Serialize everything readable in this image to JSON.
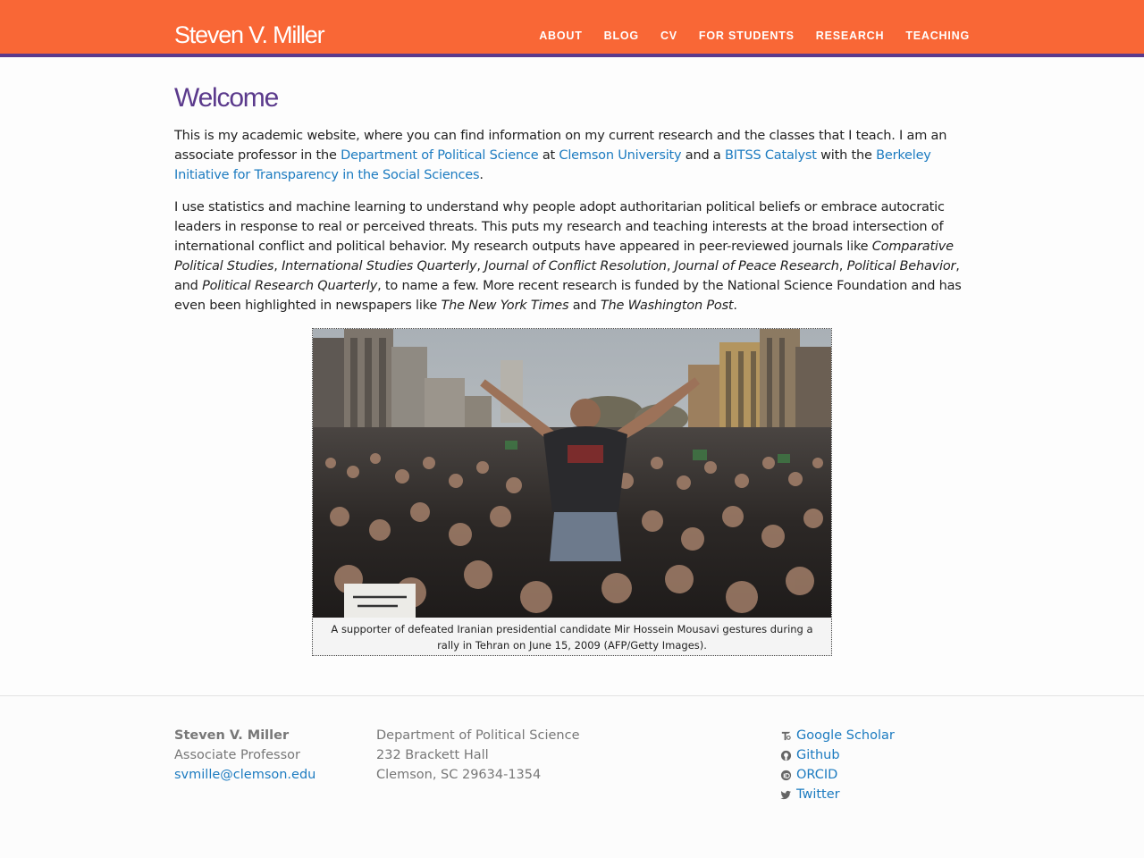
{
  "header": {
    "brand": "Steven V. Miller",
    "nav": [
      "ABOUT",
      "BLOG",
      "CV",
      "FOR STUDENTS",
      "RESEARCH",
      "TEACHING"
    ]
  },
  "main": {
    "title": "Welcome",
    "para1": {
      "t1": "This is my academic website, where you can find information on my current research and the classes that I teach. I am an associate professor in the ",
      "link_dept": "Department of Political Science",
      "t2": " at ",
      "link_clemson": "Clemson University",
      "t3": " and a ",
      "link_bitss": "BITSS Catalyst",
      "t4": " with the ",
      "link_berkeley": "Berkeley Initiative for Transparency in the Social Sciences",
      "t5": "."
    },
    "para2": {
      "t1": "I use statistics and machine learning to understand why people adopt authoritarian political beliefs or embrace autocratic leaders in response to real or perceived threats. This puts my research and teaching interests at the broad intersection of international conflict and political behavior. My research outputs have appeared in peer-reviewed journals like ",
      "j1": "Comparative Political Studies",
      "s1": ", ",
      "j2": "International Studies Quarterly",
      "s2": ", ",
      "j3": "Journal of Conflict Resolution",
      "s3": ", ",
      "j4": "Journal of Peace Research",
      "s4": ", ",
      "j5": "Political Behavior",
      "s5": ", and ",
      "j6": "Political Research Quarterly",
      "t2": ", to name a few. More recent research is funded by the National Science Foundation and has even been highlighted in newspapers like ",
      "p1": "The New York Times",
      "t3": " and ",
      "p2": "The Washington Post",
      "t4": "."
    },
    "figure": {
      "caption": "A supporter of defeated Iranian presidential candidate Mir Hossein Mousavi gestures during a rally in Tehran on June 15, 2009 (AFP/Getty Images)."
    }
  },
  "footer": {
    "name": "Steven V. Miller",
    "title": "Associate Professor",
    "email": "svmille@clemson.edu",
    "address": [
      "Department of Political Science",
      "232 Brackett Hall",
      "Clemson, SC 29634-1354"
    ],
    "links": [
      {
        "label": "Google Scholar",
        "icon": "google-scholar-icon"
      },
      {
        "label": "Github",
        "icon": "github-icon"
      },
      {
        "label": "ORCID",
        "icon": "orcid-icon"
      },
      {
        "label": "Twitter",
        "icon": "twitter-icon"
      }
    ]
  },
  "colors": {
    "header_bg": "#f96736",
    "header_border": "#5b3a8c",
    "title": "#5b3a8c",
    "link": "#1c7bc0"
  }
}
